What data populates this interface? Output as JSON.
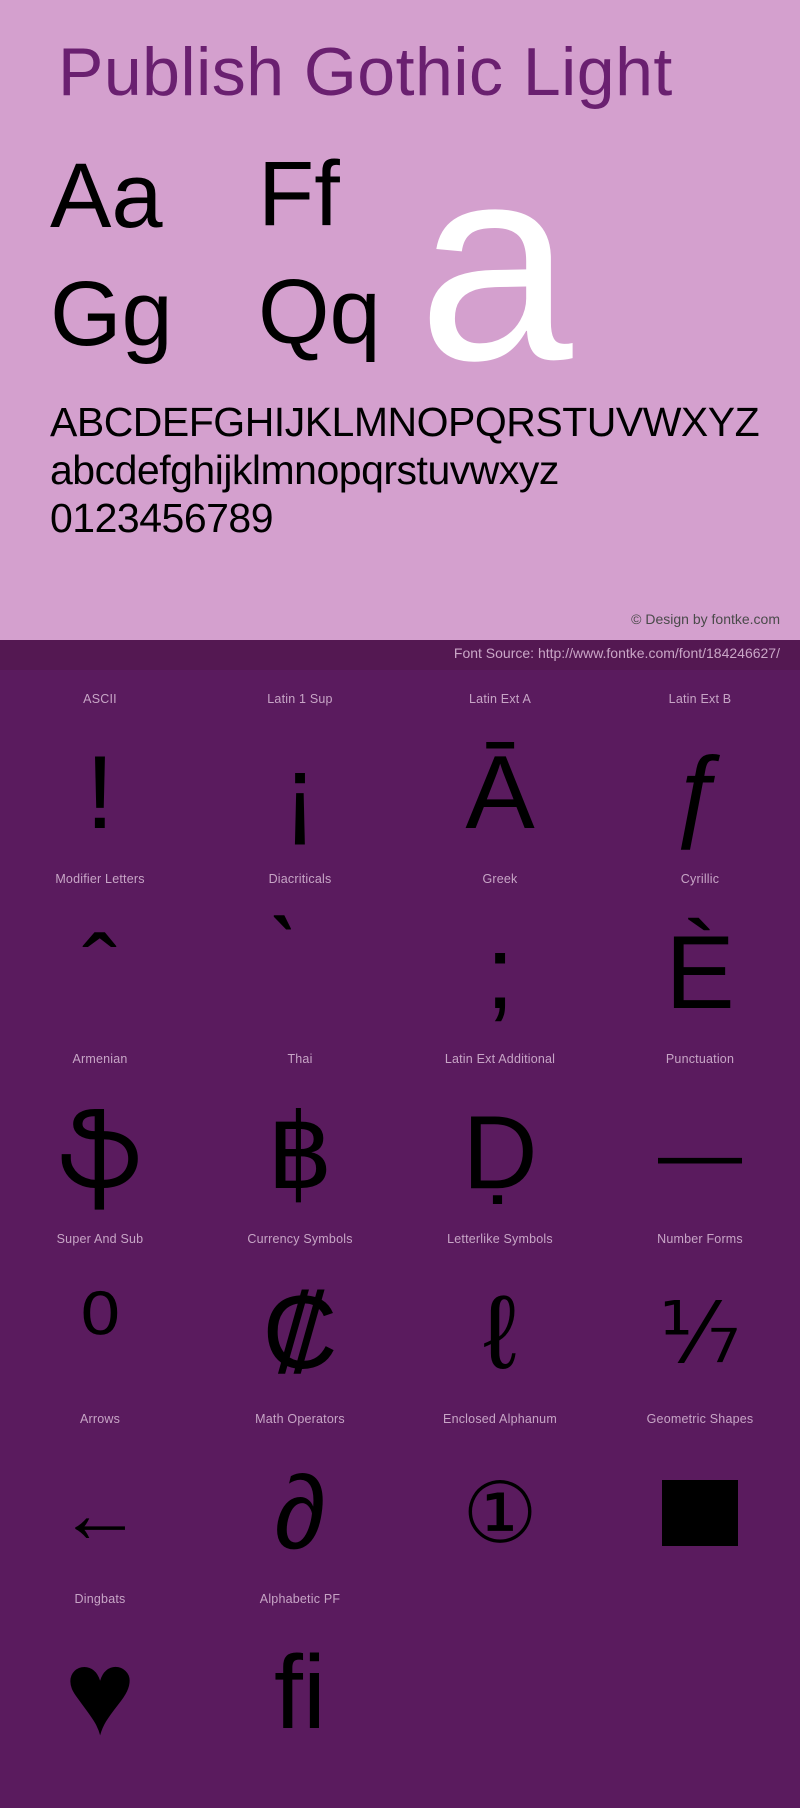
{
  "specimen": {
    "title": "Publish Gothic Light",
    "letter_pairs": [
      "Aa",
      "Ff",
      "Gg",
      "Qq"
    ],
    "big_sample": "a",
    "alphabet_uppercase": "ABCDEFGHIJKLMNOPQRSTUVWXYZ",
    "alphabet_lowercase": "abcdefghijklmnopqrstuvwxyz",
    "numerals": "0123456789",
    "copyright": "© Design by fontke.com",
    "colors": {
      "panel_background": "#d4a0ce",
      "title_color": "#6a2070",
      "glyph_color": "#000000",
      "big_sample_color": "#ffffff",
      "grid_background": "#5a1b5e",
      "source_bar_background": "#541852",
      "label_color": "#c7a5c6"
    }
  },
  "source": {
    "text": "Font Source: http://www.fontke.com/font/184246627/"
  },
  "grid": {
    "rows": [
      [
        {
          "label": "ASCII",
          "glyph": "!",
          "icon": "exclamation-glyph"
        },
        {
          "label": "Latin 1 Sup",
          "glyph": "¡",
          "icon": "inverted-exclamation-glyph"
        },
        {
          "label": "Latin Ext A",
          "glyph": "Ā",
          "icon": "a-macron-glyph"
        },
        {
          "label": "Latin Ext B",
          "glyph": "ƒ",
          "icon": "florin-glyph"
        }
      ],
      [
        {
          "label": "Modifier Letters",
          "glyph": "ˆ",
          "icon": "circumflex-glyph"
        },
        {
          "label": "Diacriticals",
          "glyph": "̀",
          "icon": "grave-accent-glyph"
        },
        {
          "label": "Greek",
          "glyph": ";",
          "icon": "greek-question-mark-glyph"
        },
        {
          "label": "Cyrillic",
          "glyph": "Ѐ",
          "icon": "cyrillic-ie-grave-glyph"
        }
      ],
      [
        {
          "label": "Armenian",
          "glyph": "ֆ",
          "icon": "armenian-feh-glyph"
        },
        {
          "label": "Thai",
          "glyph": "฿",
          "icon": "thai-baht-glyph"
        },
        {
          "label": "Latin Ext Additional",
          "glyph": "Ḍ",
          "icon": "d-dot-below-glyph"
        },
        {
          "label": "Punctuation",
          "glyph": "—",
          "icon": "em-dash-glyph"
        }
      ],
      [
        {
          "label": "Super And Sub",
          "glyph": "⁰",
          "icon": "superscript-zero-glyph"
        },
        {
          "label": "Currency Symbols",
          "glyph": "₡",
          "icon": "colon-currency-glyph"
        },
        {
          "label": "Letterlike Symbols",
          "glyph": "ℓ",
          "icon": "script-small-l-glyph"
        },
        {
          "label": "Number Forms",
          "glyph": "⅐",
          "icon": "one-seventh-fraction-glyph"
        }
      ],
      [
        {
          "label": "Arrows",
          "glyph": "←",
          "icon": "left-arrow-glyph"
        },
        {
          "label": "Math Operators",
          "glyph": "∂",
          "icon": "partial-differential-glyph"
        },
        {
          "label": "Enclosed Alphanum",
          "glyph": "①",
          "icon": "circled-one-glyph"
        },
        {
          "label": "Geometric Shapes",
          "glyph": "■",
          "icon": "black-square-glyph"
        }
      ],
      [
        {
          "label": "Dingbats",
          "glyph": "♥",
          "icon": "heart-glyph"
        },
        {
          "label": "Alphabetic PF",
          "glyph": "ﬁ",
          "icon": "fi-ligature-glyph"
        },
        {
          "label": "",
          "glyph": "",
          "icon": ""
        },
        {
          "label": "",
          "glyph": "",
          "icon": ""
        }
      ]
    ]
  }
}
